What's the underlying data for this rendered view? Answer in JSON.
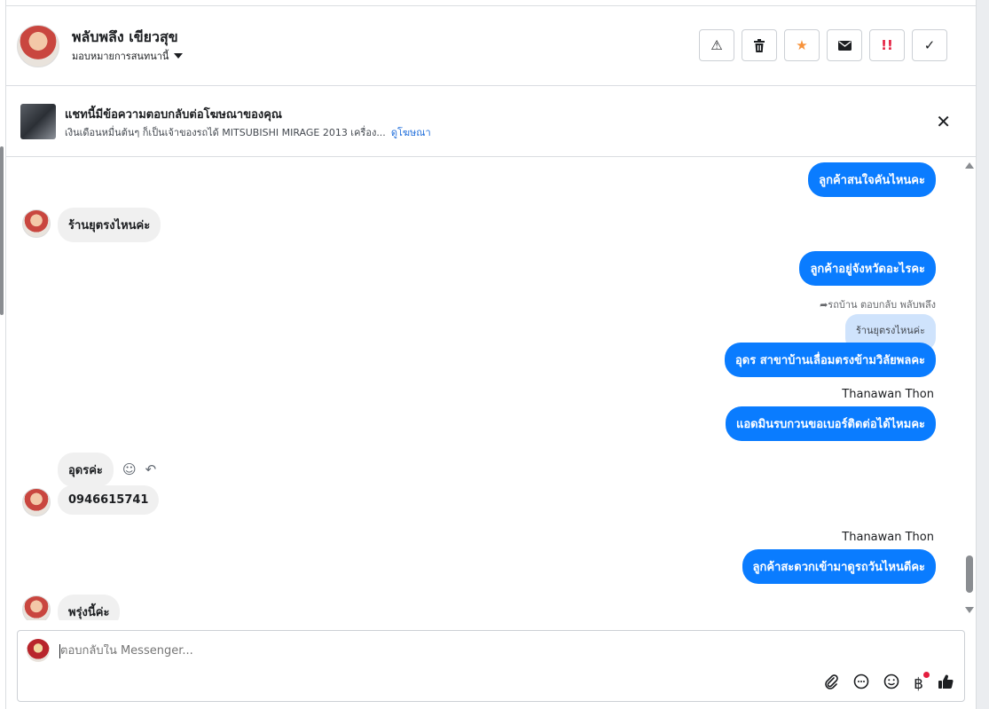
{
  "header": {
    "contact_name": "พลับพลึง เขียวสุข",
    "assign_label": "มอบหมายการสนทนานี้",
    "toolbar": [
      {
        "name": "spam-button",
        "icon": "warning-icon",
        "glyph": "⚠"
      },
      {
        "name": "delete-button",
        "icon": "trash-icon",
        "glyph": "🗑"
      },
      {
        "name": "star-button",
        "icon": "star-icon",
        "glyph": "★"
      },
      {
        "name": "unread-button",
        "icon": "envelope-icon",
        "glyph": "✉"
      },
      {
        "name": "follow-up-button",
        "icon": "exclamation-icon",
        "glyph": "!!"
      },
      {
        "name": "done-button",
        "icon": "check-icon",
        "glyph": "✓"
      }
    ]
  },
  "ad_banner": {
    "title": "แชทนี้มีข้อความตอบกลับต่อโฆษณาของคุณ",
    "description": "เงินเดือนหมื่นต้นๆ ก็เป็นเจ้าของรถได้ MITSUBISHI MIRAGE 2013 เครื่อง...",
    "link_label": "ดูโฆษณา",
    "close_glyph": "✕"
  },
  "messages": {
    "m1": "ลูกค้าสนใจคันไหนคะ",
    "m2": "ร้านยุตรงไหนค่ะ",
    "m3": "ลูกค้าอยู่จังหวัดอะไรคะ",
    "reply_meta": "รถบ้าน ตอบกลับ พลับพลึง",
    "quoted": "ร้านยุตรงไหนค่ะ",
    "m4": "อุดร สาขาบ้านเลื่อมตรงข้ามวิลัยพลคะ",
    "sender_1": "Thanawan Thon",
    "m5": "แอดมินรบกวนขอเบอร์ติดต่อได้ไหมคะ",
    "m6": "อุดรค่ะ",
    "m7": "0946615741",
    "sender_2": "Thanawan Thon",
    "m8": "ลูกค้าสะดวกเข้ามาดูรถวันไหนดีคะ",
    "m9": "พรุ่งนี้ค่ะ"
  },
  "composer": {
    "placeholder": "ตอบกลับใน Messenger..."
  }
}
